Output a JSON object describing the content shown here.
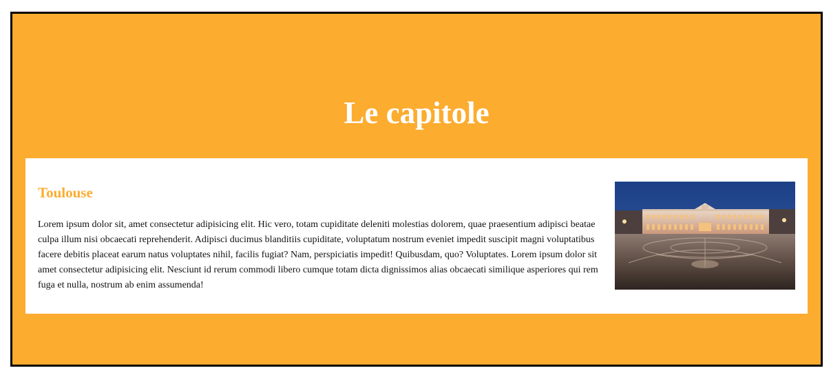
{
  "header": {
    "title": "Le capitole"
  },
  "card": {
    "subtitle": "Toulouse",
    "text": "Lorem ipsum dolor sit, amet consectetur adipisicing elit. Hic vero, totam cupiditate deleniti molestias dolorem, quae praesentium adipisci beatae culpa illum nisi obcaecati reprehenderit. Adipisci ducimus blanditiis cupiditate, voluptatum nostrum eveniet impedit suscipit magni voluptatibus facere debitis placeat earum natus voluptates nihil, facilis fugiat? Nam, perspiciatis impedit! Quibusdam, quo? Voluptates. Lorem ipsum dolor sit amet consectetur adipisicing elit. Nesciunt id rerum commodi libero cumque totam dicta dignissimos alias obcaecati similique asperiores qui rem fuga et nulla, nostrum ab enim assumenda!"
  },
  "colors": {
    "accent": "#fcac2f",
    "border": "#000000",
    "card_background": "#ffffff",
    "title_text": "#ffffff"
  }
}
